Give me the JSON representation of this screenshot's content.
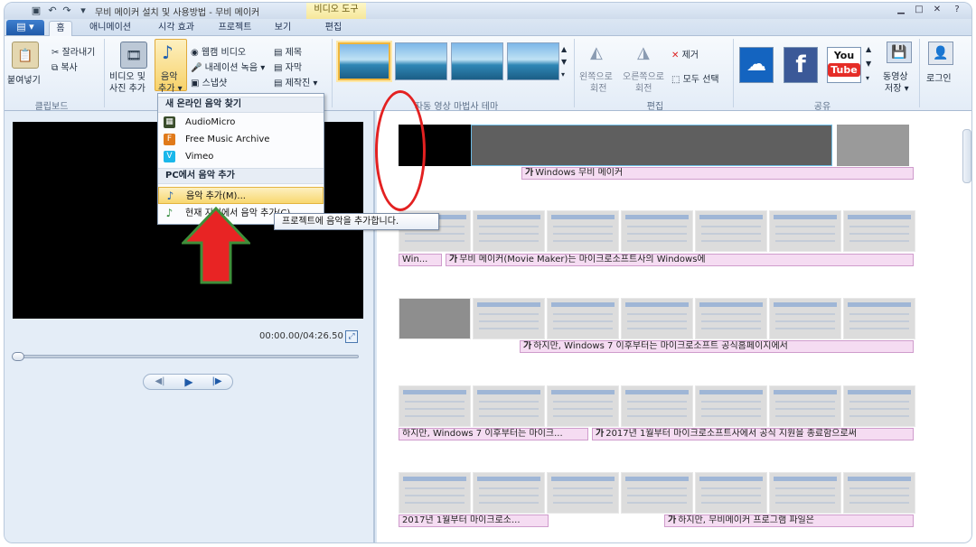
{
  "window": {
    "title": "무비 메이커 설치 및 사용방법 - 무비 메이커",
    "context_tab": "비디오 도구"
  },
  "tabs": [
    {
      "label": "홈",
      "active": true
    },
    {
      "label": "애니메이션"
    },
    {
      "label": "시각 효과"
    },
    {
      "label": "프로젝트"
    },
    {
      "label": "보기"
    },
    {
      "label": "편집"
    }
  ],
  "ribbon": {
    "clipboard": {
      "paste": "붙여넣기",
      "cut": "잘라내기",
      "copy": "복사",
      "label": "클립보드"
    },
    "add": {
      "video_photo_1": "비디오 및",
      "video_photo_2": "사진 추가",
      "music_1": "음악",
      "music_2": "추가 ▾",
      "webcam": "웹캠 비디오",
      "narration": "내레이션 녹음 ▾",
      "snapshot": "스냅샷",
      "title": "제목",
      "caption": "자막",
      "credits": "제작진 ▾"
    },
    "themes": {
      "label": "자동 영상 마법사 테마"
    },
    "editing": {
      "rotate_left_1": "왼쪽으로",
      "rotate_left_2": "회전",
      "rotate_right_1": "오른쪽으로",
      "rotate_right_2": "회전",
      "remove": "제거",
      "select_all": "모두 선택",
      "label": "편집"
    },
    "share": {
      "youtube_1": "You",
      "youtube_2": "Tube",
      "save_movie_1": "동영상",
      "save_movie_2": "저장 ▾",
      "login": "로그인",
      "label": "공유"
    }
  },
  "player": {
    "timecode": "00:00.00/04:26.50"
  },
  "menu": {
    "online_header": "새 온라인 음악 찾기",
    "items_online": [
      "AudioMicro",
      "Free Music Archive",
      "Vimeo"
    ],
    "pc_header": "PC에서 음악 추가",
    "add_music": "음악 추가(M)...",
    "add_at_current": "현재 지점에서 음악 추가(C)..."
  },
  "tooltip": "프로젝트에 음악을 추가합니다.",
  "storyboard": {
    "captions": [
      {
        "text": "Windows 무비 메이커",
        "icon": "가"
      },
      {
        "text": "Win...",
        "icon": ""
      },
      {
        "text": "무비 메이커(Movie Maker)는 마이크로소프트사의 Windows에",
        "icon": "가"
      },
      {
        "text": "하지만, Windows 7 이후부터는 마이크로소프트 공식홈페이지에서",
        "icon": "가"
      },
      {
        "text": "하지만, Windows 7 이후부터는 마이크...",
        "icon": ""
      },
      {
        "text": "2017년 1월부터 마이크로소프트사에서 공식 지원을 종료함으로써",
        "icon": "가"
      },
      {
        "text": "2017년 1월부터 마이크로소...",
        "icon": ""
      },
      {
        "text": "하지만, 무비메이커 프로그램 파일은",
        "icon": "가"
      }
    ]
  },
  "colors": {
    "accent": "#1f5aa8",
    "annotation_red": "#e32121",
    "caption_bg": "#f5dcf2"
  }
}
